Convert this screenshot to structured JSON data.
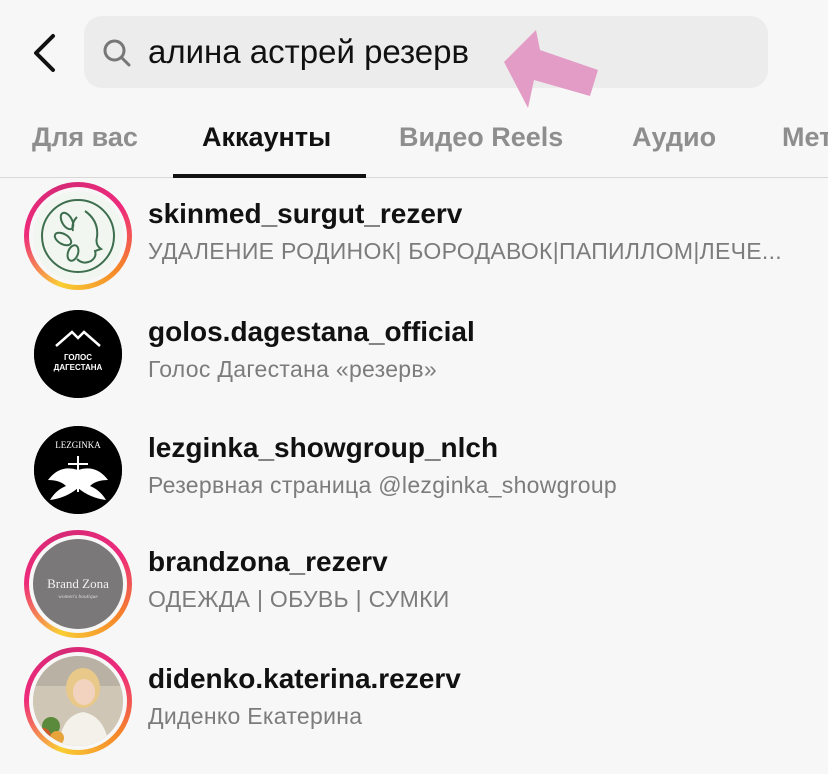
{
  "search": {
    "query": "алина астрей резерв"
  },
  "tabs": [
    {
      "label": "Для вас",
      "active": false
    },
    {
      "label": "Аккаунты",
      "active": true
    },
    {
      "label": "Видео Reels",
      "active": false
    },
    {
      "label": "Аудио",
      "active": false
    },
    {
      "label": "Мет",
      "active": false
    }
  ],
  "accounts": [
    {
      "username": "skinmed_surgut_rezerv",
      "subtitle": "УДАЛЕНИЕ РОДИНОК| БОРОДАВОК|ПАПИЛЛОМ|ЛЕЧЕ...",
      "story_ring": true
    },
    {
      "username": "golos.dagestana_official",
      "subtitle": "Голос Дагестана «резерв»",
      "story_ring": false,
      "avatar_text": [
        "ГОЛОС",
        "ДАГЕСТАНА"
      ]
    },
    {
      "username": "lezginka_showgroup_nlch",
      "subtitle": "Резервная страница @lezginka_showgroup",
      "story_ring": false,
      "avatar_text": [
        "LEZGINKA"
      ]
    },
    {
      "username": "brandzona_rezerv",
      "subtitle": "ОДЕЖДА | ОБУВЬ | СУМКИ",
      "story_ring": true,
      "avatar_text": [
        "Brand Zona",
        "women's boutique"
      ]
    },
    {
      "username": "didenko.katerina.rezerv",
      "subtitle": "Диденко Екатерина",
      "story_ring": true
    }
  ],
  "colors": {
    "accent_arrow": "#e39cc6",
    "ring_start": "#f9ce34",
    "ring_mid": "#ee2a7b"
  },
  "icons": {
    "back": "chevron-left-icon",
    "search": "search-icon",
    "pointer": "arrow-pointer-icon"
  }
}
